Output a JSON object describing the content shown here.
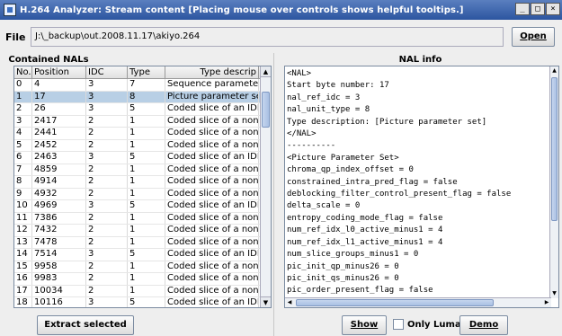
{
  "window": {
    "title": "H.264 Analyzer: Stream content    [Placing mouse over controls shows helpful tooltips.]",
    "minimize": "_",
    "maximize": "□",
    "close": "×"
  },
  "file": {
    "label": "File",
    "path": "J:\\_backup\\out.2008.11.17\\akiyo.264",
    "open_label": "Open"
  },
  "left_panel": {
    "title": "Contained NALs",
    "columns": [
      "No.",
      "Position",
      "IDC",
      "Type",
      "Type descrip"
    ],
    "selected_index": 1,
    "rows": [
      [
        "0",
        "4",
        "3",
        "7",
        "Sequence parameter s"
      ],
      [
        "1",
        "17",
        "3",
        "8",
        "Picture parameter set"
      ],
      [
        "2",
        "26",
        "3",
        "5",
        "Coded slice of an IDR"
      ],
      [
        "3",
        "2417",
        "2",
        "1",
        "Coded slice of a non-I"
      ],
      [
        "4",
        "2441",
        "2",
        "1",
        "Coded slice of a non-I"
      ],
      [
        "5",
        "2452",
        "2",
        "1",
        "Coded slice of a non-I"
      ],
      [
        "6",
        "2463",
        "3",
        "5",
        "Coded slice of an IDR"
      ],
      [
        "7",
        "4859",
        "2",
        "1",
        "Coded slice of a non-I"
      ],
      [
        "8",
        "4914",
        "2",
        "1",
        "Coded slice of a non-I"
      ],
      [
        "9",
        "4932",
        "2",
        "1",
        "Coded slice of a non-I"
      ],
      [
        "10",
        "4969",
        "3",
        "5",
        "Coded slice of an IDR"
      ],
      [
        "11",
        "7386",
        "2",
        "1",
        "Coded slice of a non-I"
      ],
      [
        "12",
        "7432",
        "2",
        "1",
        "Coded slice of a non-I"
      ],
      [
        "13",
        "7478",
        "2",
        "1",
        "Coded slice of a non-I"
      ],
      [
        "14",
        "7514",
        "3",
        "5",
        "Coded slice of an IDR"
      ],
      [
        "15",
        "9958",
        "2",
        "1",
        "Coded slice of a non-I"
      ],
      [
        "16",
        "9983",
        "2",
        "1",
        "Coded slice of a non-I"
      ],
      [
        "17",
        "10034",
        "2",
        "1",
        "Coded slice of a non-I"
      ],
      [
        "18",
        "10116",
        "3",
        "5",
        "Coded slice of an IDR"
      ]
    ],
    "extract_label": "Extract selected"
  },
  "right_panel": {
    "title": "NAL info",
    "lines": [
      "<NAL>",
      "Start byte number: 17",
      "nal_ref_idc = 3",
      "nal_unit_type = 8",
      "Type description: [Picture parameter set]",
      "</NAL>",
      "----------",
      "<Picture Parameter Set>",
      "chroma_qp_index_offset = 0",
      "constrained_intra_pred_flag = false",
      "deblocking_filter_control_present_flag = false",
      "delta_scale = 0",
      "entropy_coding_mode_flag = false",
      "num_ref_idx_l0_active_minus1 = 4",
      "num_ref_idx_l1_active_minus1 = 4",
      "num_slice_groups_minus1 = 0",
      "pic_init_qp_minus26 = 0",
      "pic_init_qs_minus26 = 0",
      "pic_order_present_flag = false"
    ],
    "show_label": "Show",
    "only_luma_label": "Only Luma",
    "demo_label": "Demo"
  }
}
